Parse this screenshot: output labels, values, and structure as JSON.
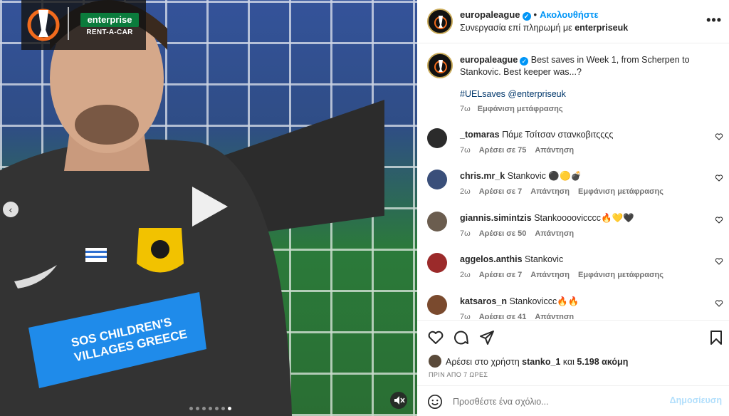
{
  "media": {
    "sponsor_name": "enterprise",
    "sponsor_sub": "RENT-A-CAR",
    "carousel_dots": 7,
    "carousel_active": 7,
    "shirt_text": "SOS CHILDREN'S VILLAGES GREECE"
  },
  "header": {
    "username": "europaleague",
    "bullet": "•",
    "follow": "Ακολουθήστε",
    "partnership_prefix": "Συνεργασία επί πληρωμή με ",
    "partner": "enterpriseuk",
    "more": "•••"
  },
  "caption": {
    "username": "europaleague",
    "text": "Best saves in Week 1, from Scherpen to Stankovic. Best keeper was...?",
    "tags": "#UELsaves @enterpriseuk",
    "time": "7ω",
    "translate": "Εμφάνιση μετάφρασης"
  },
  "comments": [
    {
      "username": "_tomaras",
      "text": "Πάμε Τσίτσαν στανκοβιτςςςς",
      "time": "7ω",
      "likes": "Αρέσει σε 75",
      "reply": "Απάντηση",
      "translate": "",
      "avatar_color": "#2b2b2b"
    },
    {
      "username": "chris.mr_k",
      "text": "Stankovic ⚫🟡💣",
      "time": "2ω",
      "likes": "Αρέσει σε 7",
      "reply": "Απάντηση",
      "translate": "Εμφάνιση μετάφρασης",
      "avatar_color": "#3a4f7a"
    },
    {
      "username": "giannis.simintzis",
      "text": "Stankoooovicccc🔥💛🖤",
      "time": "7ω",
      "likes": "Αρέσει σε 50",
      "reply": "Απάντηση",
      "translate": "",
      "avatar_color": "#6b5d4f"
    },
    {
      "username": "aggelos.anthis",
      "text": "Stankovic",
      "time": "2ω",
      "likes": "Αρέσει σε 7",
      "reply": "Απάντηση",
      "translate": "Εμφάνιση μετάφρασης",
      "avatar_color": "#9b2a2a"
    },
    {
      "username": "katsaros_n",
      "text": "Stankoviccc🔥🔥",
      "time": "7ω",
      "likes": "Αρέσει σε 41",
      "reply": "Απάντηση",
      "translate": "",
      "avatar_color": "#7a4a2e"
    }
  ],
  "likes": {
    "prefix": "Αρέσει στο χρήστη ",
    "user": "stanko_1",
    "middle": " και ",
    "count": "5.198 ακόμη"
  },
  "time_ago": "ΠΡΙΝ ΑΠΟ 7 ΩΡΕΣ",
  "add_comment": {
    "placeholder": "Προσθέστε ένα σχόλιο...",
    "post_label": "Δημοσίευση"
  },
  "colors": {
    "accent": "#0095f6",
    "link": "#00376b",
    "muted": "#737373",
    "post_disabled": "#b2dffc"
  }
}
